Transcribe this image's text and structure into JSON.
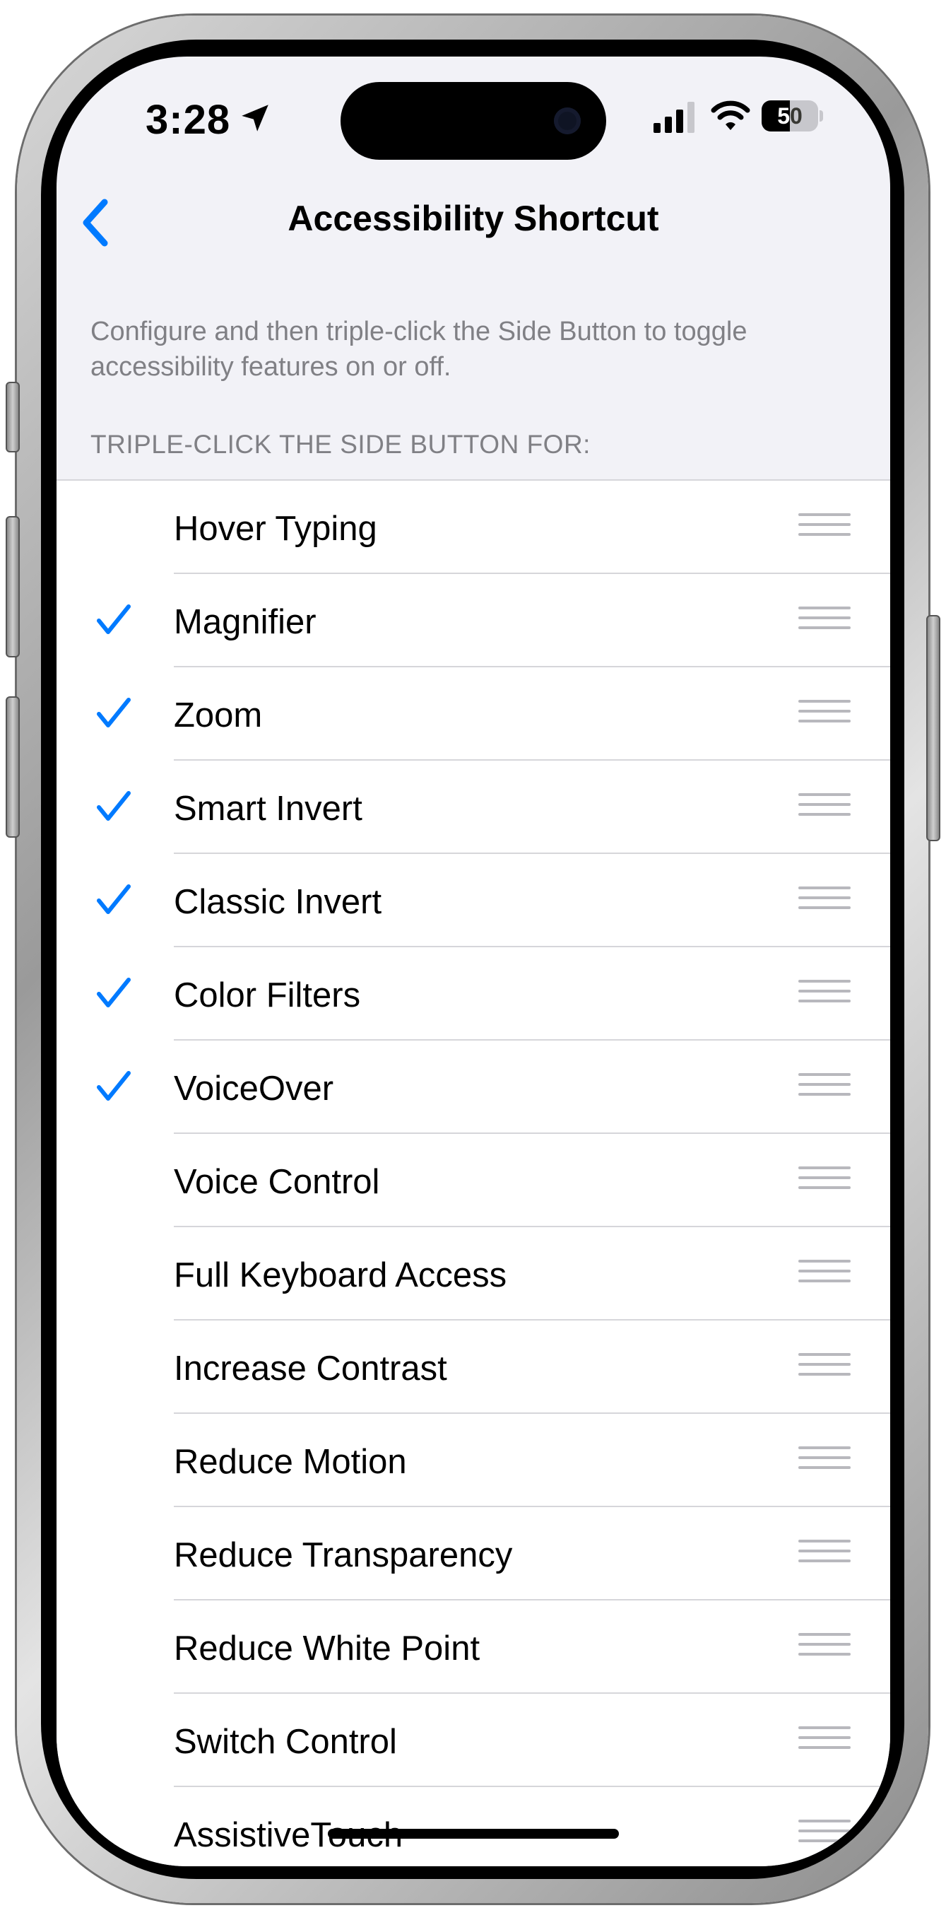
{
  "status_bar": {
    "time": "3:28",
    "battery_level": "50",
    "battery_fraction": 0.5
  },
  "nav": {
    "title": "Accessibility Shortcut",
    "back_icon": "chevron-left-icon"
  },
  "description": "Configure and then triple-click the Side Button to toggle accessibility features on or off.",
  "section_header": "TRIPLE-CLICK THE SIDE BUTTON FOR:",
  "accent_color": "#007aff",
  "items": [
    {
      "label": "Hover Typing",
      "checked": false
    },
    {
      "label": "Magnifier",
      "checked": true
    },
    {
      "label": "Zoom",
      "checked": true
    },
    {
      "label": "Smart Invert",
      "checked": true
    },
    {
      "label": "Classic Invert",
      "checked": true
    },
    {
      "label": "Color Filters",
      "checked": true
    },
    {
      "label": "VoiceOver",
      "checked": true
    },
    {
      "label": "Voice Control",
      "checked": false
    },
    {
      "label": "Full Keyboard Access",
      "checked": false
    },
    {
      "label": "Increase Contrast",
      "checked": false
    },
    {
      "label": "Reduce Motion",
      "checked": false
    },
    {
      "label": "Reduce Transparency",
      "checked": false
    },
    {
      "label": "Reduce White Point",
      "checked": false
    },
    {
      "label": "Switch Control",
      "checked": false
    },
    {
      "label": "AssistiveTouch",
      "checked": false
    }
  ]
}
